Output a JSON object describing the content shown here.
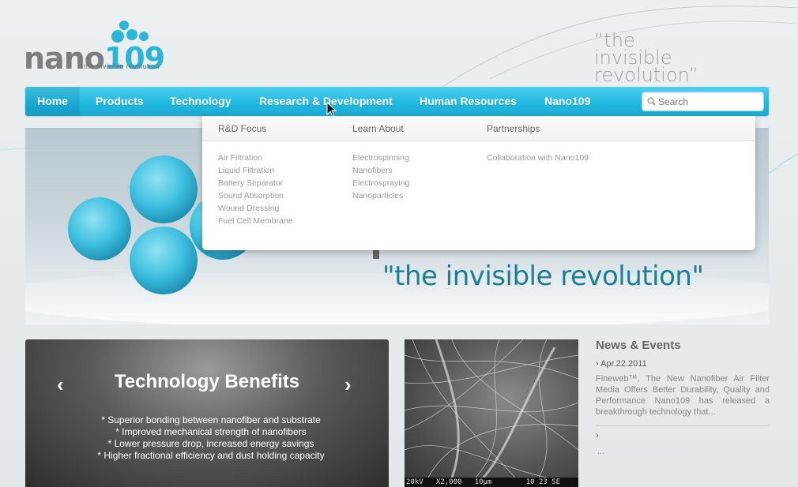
{
  "brand": {
    "logo_word": "nano",
    "logo_num": "109",
    "logo_tagline": "the invisible revolution",
    "tagline_line1": "“the",
    "tagline_line2": "invisible revolution”"
  },
  "nav": {
    "items": [
      {
        "label": "Home"
      },
      {
        "label": "Products"
      },
      {
        "label": "Technology"
      },
      {
        "label": "Research & Development"
      },
      {
        "label": "Human Resources"
      },
      {
        "label": "Nano109"
      }
    ],
    "search_placeholder": "Search"
  },
  "dropdown": {
    "columns": [
      {
        "title": "R&D Focus",
        "items": [
          "Air Filtration",
          "Liquid Filtration",
          "Battery Separator",
          "Sound Absorption",
          "Wound Dressing",
          "Fuel Cell Membrane"
        ]
      },
      {
        "title": "Learn About",
        "items": [
          "Electrospinning",
          "Nanofibers",
          "Electrospraying",
          "Nanoparticles"
        ]
      },
      {
        "title": "Partnerships",
        "items": [
          "Collaboration with Nano109"
        ]
      }
    ]
  },
  "hero": {
    "quote": "\"the invisible revolution\""
  },
  "benefits": {
    "title": "Technology Benefits",
    "prev": "‹",
    "next": "›",
    "items": [
      "* Superior bonding between nanofiber and substrate",
      "* Improved mechanical strength of nanofibers",
      "* Lower pressure drop, increased energy savings",
      "* Higher fractional efficiency and dust holding capacity"
    ]
  },
  "sem_image": {
    "caption": "20kV   X2,000   10µm        10 23 SE"
  },
  "news": {
    "title": "News & Events",
    "date": "› Apr.22.2011",
    "body": "Fineweb™, The New Nanofiber Air Filter Media Offers Better Durability, Quality and Performance Nano109 has released a breakthrough technology that...",
    "more": "›",
    "ellipsis": "..."
  },
  "colors": {
    "nav_accent": "#22b8e0",
    "hero_quote": "#1a7f93",
    "logo_blue": "#2ab6d9"
  }
}
